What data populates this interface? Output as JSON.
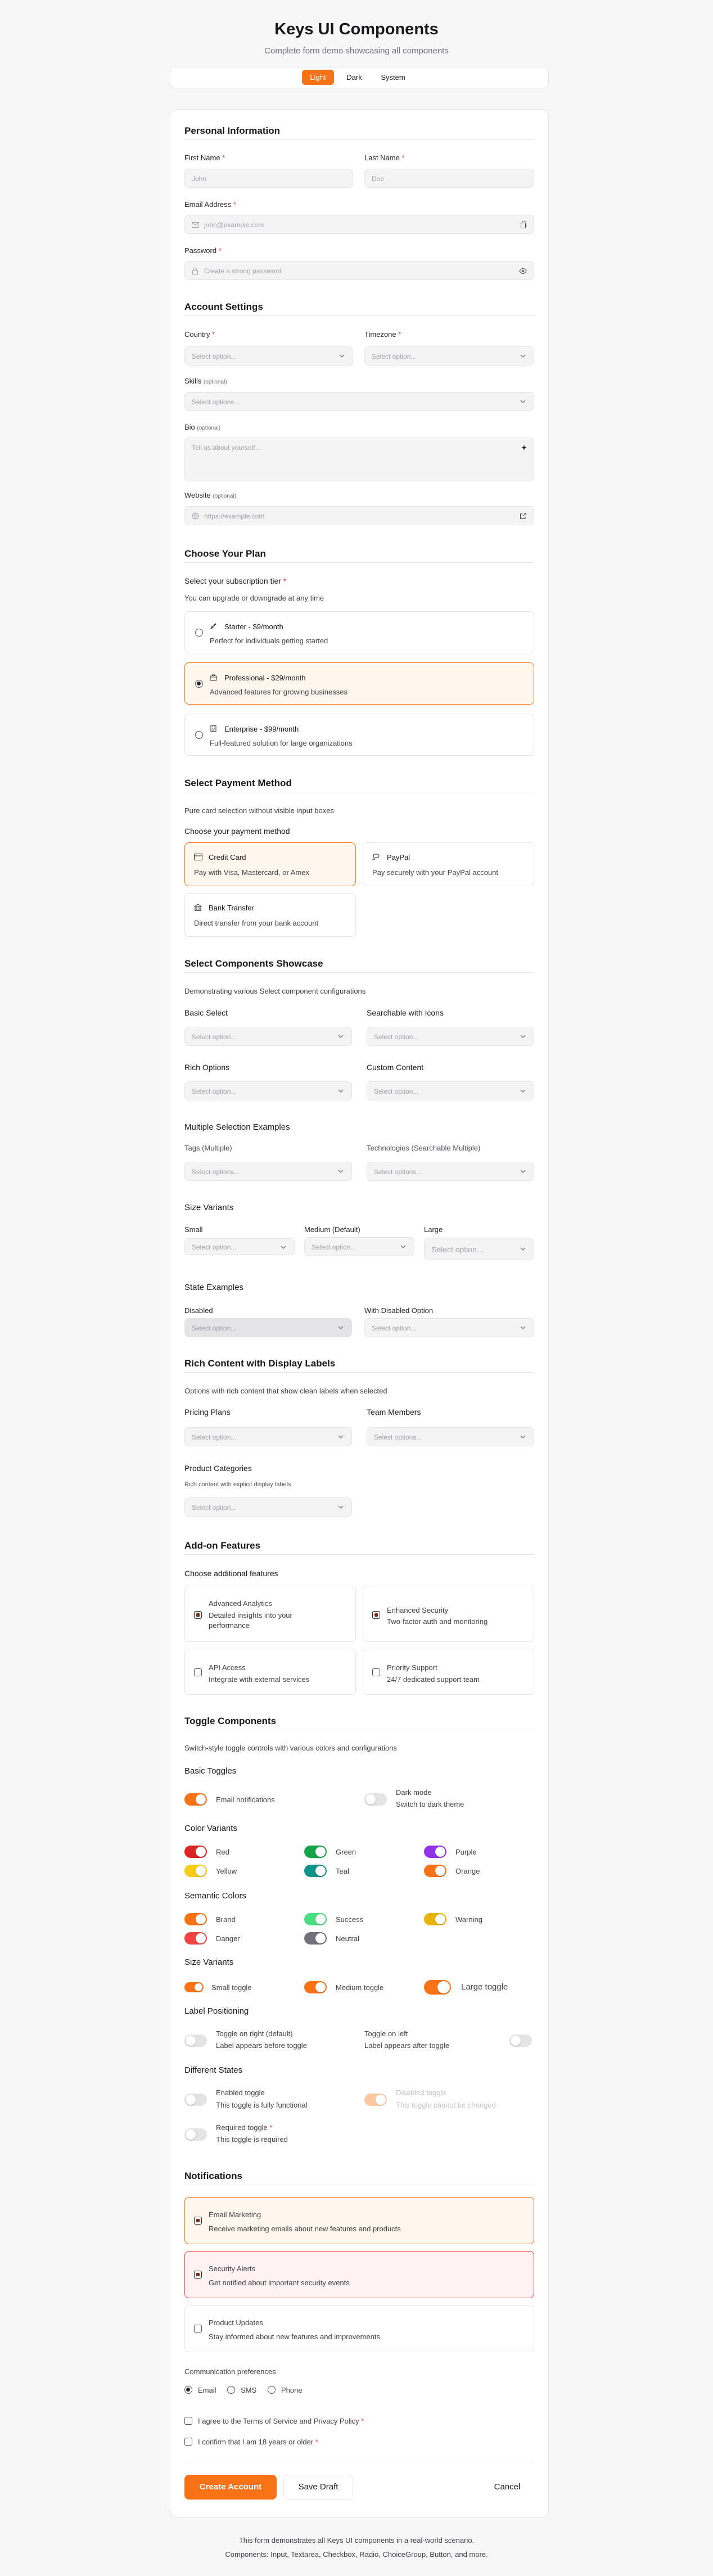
{
  "header": {
    "title": "Keys UI Components",
    "subtitle": "Complete form demo showcasing all components"
  },
  "theme": {
    "options": [
      "Light",
      "Dark",
      "System"
    ],
    "selected": "Light"
  },
  "colors": {
    "accent": "#f97316",
    "danger": "#ef4444"
  },
  "personal": {
    "heading": "Personal Information",
    "first_name_label": "First Name",
    "first_name_placeholder": "John",
    "last_name_label": "Last Name",
    "last_name_placeholder": "Doe",
    "email_label": "Email Address",
    "email_placeholder": "john@example.com",
    "password_label": "Password",
    "password_placeholder": "Create a strong password"
  },
  "account": {
    "heading": "Account Settings",
    "country_label": "Country",
    "timezone_label": "Timezone",
    "skills_label": "Skills",
    "bio_label": "Bio",
    "bio_placeholder": "Tell us about yourself...",
    "website_label": "Website",
    "website_placeholder": "https://example.com",
    "optional": "(optional)",
    "select_placeholder": "Select option...",
    "select_options_placeholder": "Select options..."
  },
  "plan": {
    "heading": "Choose Your Plan",
    "question": "Select your subscription tier",
    "hint": "You can upgrade or downgrade at any time",
    "options": [
      {
        "title": "Starter - $9/month",
        "desc": "Perfect for individuals getting started",
        "icon": "rocket-icon"
      },
      {
        "title": "Professional - $29/month",
        "desc": "Advanced features for growing businesses",
        "icon": "briefcase-icon",
        "selected": true
      },
      {
        "title": "Enterprise - $99/month",
        "desc": "Full-featured solution for large organizations",
        "icon": "building-icon"
      }
    ]
  },
  "payment": {
    "heading": "Select Payment Method",
    "desc": "Pure card selection without visible input boxes",
    "question": "Choose your payment method",
    "options": [
      {
        "title": "Credit Card",
        "desc": "Pay with Visa, Mastercard, or Amex",
        "icon": "credit-card-icon",
        "selected": true
      },
      {
        "title": "PayPal",
        "desc": "Pay securely with your PayPal account",
        "icon": "paypal-icon"
      },
      {
        "title": "Bank Transfer",
        "desc": "Direct transfer from your bank account",
        "icon": "bank-icon"
      }
    ]
  },
  "showcase": {
    "heading": "Select Components Showcase",
    "desc": "Demonstrating various Select component configurations",
    "basic": "Basic Select",
    "searchable": "Searchable with Icons",
    "rich": "Rich Options",
    "custom": "Custom Content",
    "multi_heading": "Multiple Selection Examples",
    "tags": "Tags (Multiple)",
    "tech": "Technologies (Searchable Multiple)",
    "size_heading": "Size Variants",
    "small": "Small",
    "medium": "Medium (Default)",
    "large": "Large",
    "state_heading": "State Examples",
    "disabled": "Disabled",
    "with_disabled": "With Disabled Option"
  },
  "rich": {
    "heading": "Rich Content with Display Labels",
    "desc": "Options with rich content that show clean labels when selected",
    "pricing": "Pricing Plans",
    "team": "Team Members",
    "categories": "Product Categories",
    "categories_hint": "Rich content with explicit display labels"
  },
  "addons": {
    "heading": "Add-on Features",
    "question": "Choose additional features",
    "items": [
      {
        "title": "Advanced Analytics",
        "desc": "Detailed insights into your performance",
        "checked": true
      },
      {
        "title": "Enhanced Security",
        "desc": "Two-factor auth and monitoring",
        "checked": true
      },
      {
        "title": "API Access",
        "desc": "Integrate with external services",
        "checked": false
      },
      {
        "title": "Priority Support",
        "desc": "24/7 dedicated support team",
        "checked": false
      }
    ]
  },
  "toggles": {
    "heading": "Toggle Components",
    "desc": "Switch-style toggle controls with various colors and configurations",
    "basic": "Basic Toggles",
    "email_notifications": "Email notifications",
    "dark_mode": "Dark mode",
    "dark_mode_desc": "Switch to dark theme",
    "color_heading": "Color Variants",
    "colors": [
      {
        "label": "Red",
        "color": "#dc2626"
      },
      {
        "label": "Green",
        "color": "#16a34a"
      },
      {
        "label": "Purple",
        "color": "#9333ea"
      },
      {
        "label": "Yellow",
        "color": "#facc15"
      },
      {
        "label": "Teal",
        "color": "#0d9488"
      },
      {
        "label": "Orange",
        "color": "#f97316"
      }
    ],
    "semantic_heading": "Semantic Colors",
    "semantic": [
      {
        "label": "Brand",
        "color": "#f97316"
      },
      {
        "label": "Success",
        "color": "#4ade80"
      },
      {
        "label": "Warning",
        "color": "#eab308"
      },
      {
        "label": "Danger",
        "color": "#ef4444"
      },
      {
        "label": "Neutral",
        "color": "#71717a"
      }
    ],
    "size_heading": "Size Variants",
    "small": "Small toggle",
    "medium": "Medium toggle",
    "large": "Large toggle",
    "position_heading": "Label Positioning",
    "right_label": "Toggle on right (default)",
    "right_desc": "Label appears before toggle",
    "left_label": "Toggle on left",
    "left_desc": "Label appears after toggle",
    "states_heading": "Different States",
    "enabled": "Enabled toggle",
    "enabled_desc": "This toggle is fully functional",
    "disabled": "Disabled toggle",
    "disabled_desc": "This toggle cannot be changed",
    "required": "Required toggle",
    "required_desc": "This toggle is required"
  },
  "notifications": {
    "heading": "Notifications",
    "items": [
      {
        "title": "Email Marketing",
        "desc": "Receive marketing emails about new features and products",
        "checked": true
      },
      {
        "title": "Security Alerts",
        "desc": "Get notified about important security events",
        "checked": true
      },
      {
        "title": "Product Updates",
        "desc": "Stay informed about new features and improvements",
        "checked": false
      }
    ],
    "pref_label": "Communication preferences",
    "prefs": [
      "Email",
      "SMS",
      "Phone"
    ],
    "pref_selected": "Email"
  },
  "terms": {
    "tos": "I agree to the Terms of Service and Privacy Policy",
    "age": "I confirm that I am 18 years or older"
  },
  "actions": {
    "create": "Create Account",
    "draft": "Save Draft",
    "cancel": "Cancel"
  },
  "footer": {
    "line1": "This form demonstrates all Keys UI components in a real-world scenario.",
    "line2": "Components: Input, Textarea, Checkbox, Radio, ChoiceGroup, Button, and more."
  }
}
